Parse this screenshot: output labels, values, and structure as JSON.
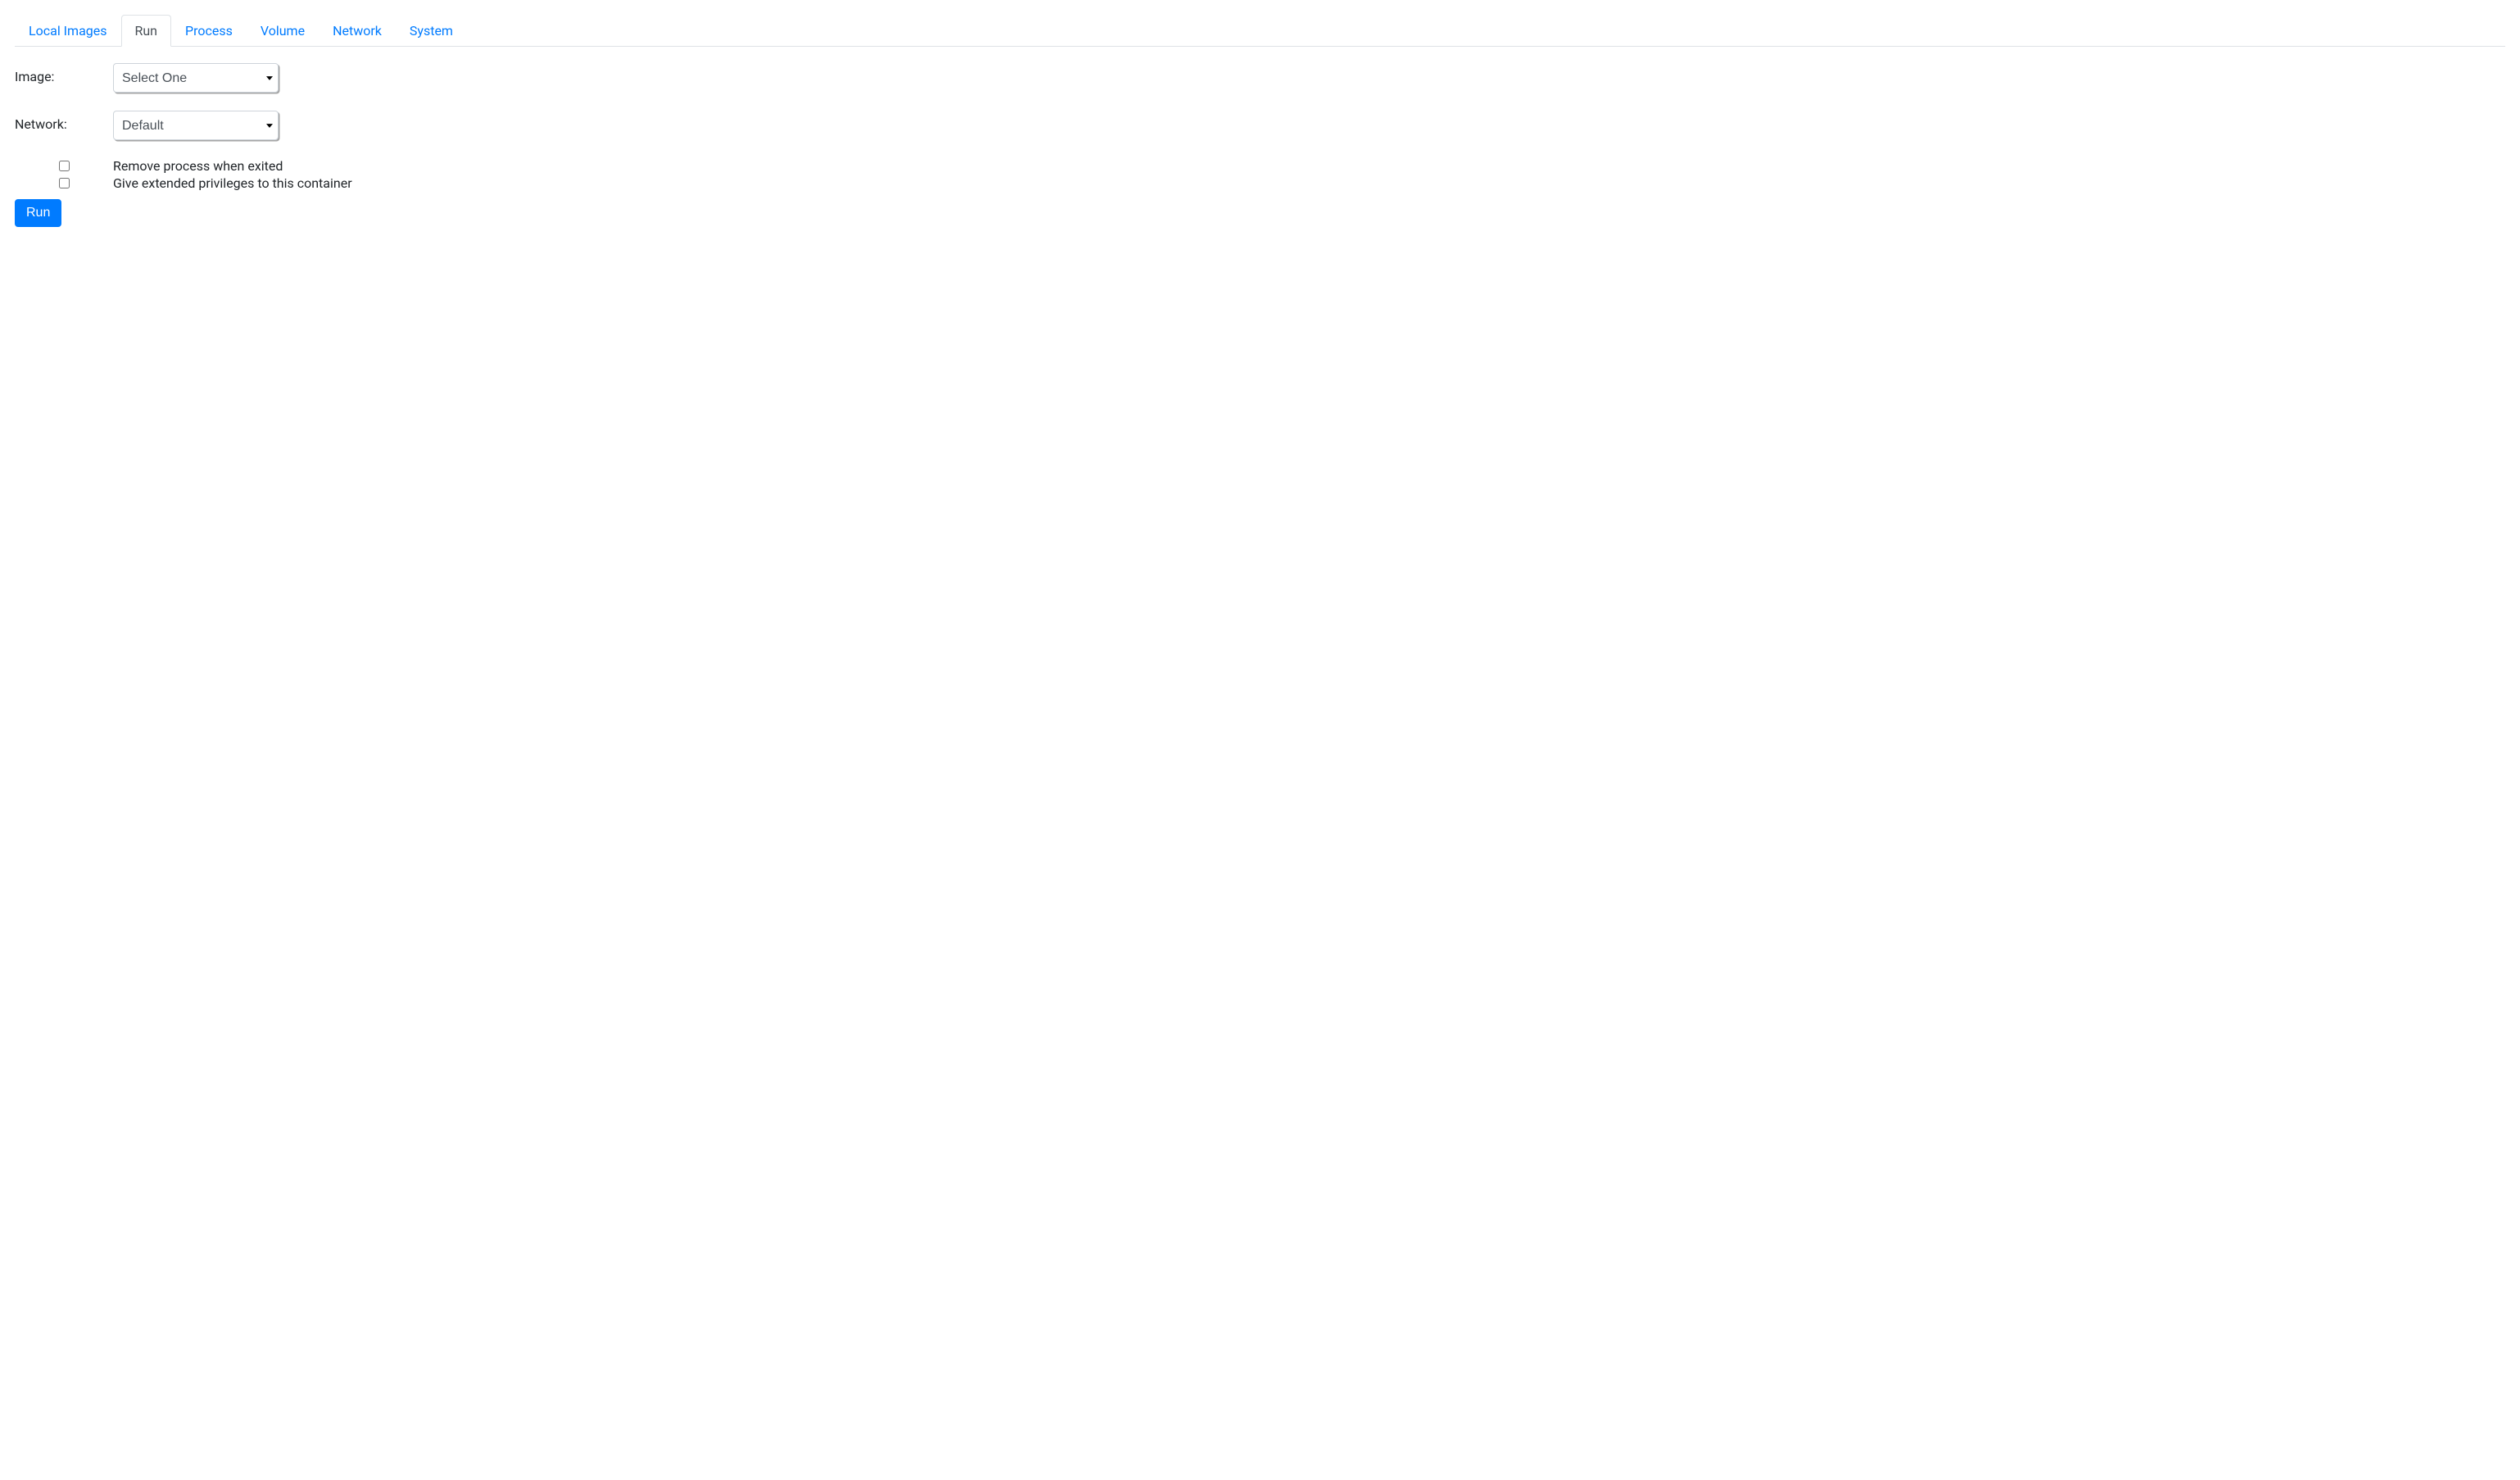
{
  "tabs": [
    {
      "label": "Local Images",
      "active": false
    },
    {
      "label": "Run",
      "active": true
    },
    {
      "label": "Process",
      "active": false
    },
    {
      "label": "Volume",
      "active": false
    },
    {
      "label": "Network",
      "active": false
    },
    {
      "label": "System",
      "active": false
    }
  ],
  "form": {
    "image": {
      "label": "Image:",
      "selected": "Select One"
    },
    "network": {
      "label": "Network:",
      "selected": "Default"
    },
    "checkboxes": [
      {
        "label": "Remove process when exited",
        "checked": false
      },
      {
        "label": "Give extended privileges to this container",
        "checked": false
      }
    ],
    "submit_label": "Run"
  }
}
